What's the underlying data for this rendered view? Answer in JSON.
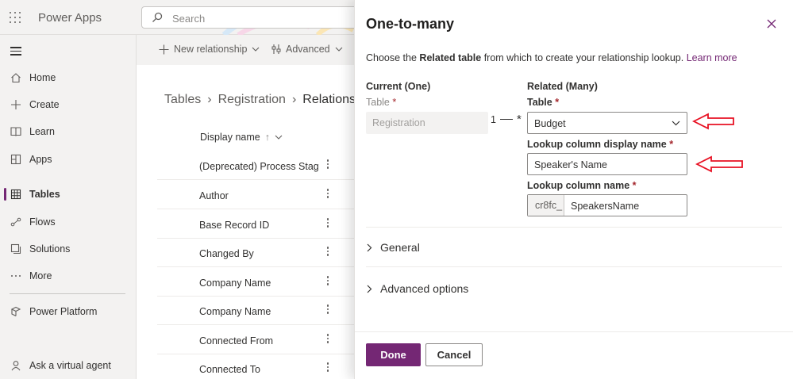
{
  "header": {
    "app_name": "Power Apps",
    "search_placeholder": "Search"
  },
  "nav": {
    "items": [
      {
        "label": "Home",
        "icon": "home-icon"
      },
      {
        "label": "Create",
        "icon": "plus-icon"
      },
      {
        "label": "Learn",
        "icon": "book-icon"
      },
      {
        "label": "Apps",
        "icon": "apps-icon"
      },
      {
        "label": "Tables",
        "icon": "table-icon",
        "active": true
      },
      {
        "label": "Flows",
        "icon": "flow-icon"
      },
      {
        "label": "Solutions",
        "icon": "solutions-icon"
      },
      {
        "label": "More",
        "icon": "ellipsis-icon"
      },
      {
        "label": "Power Platform",
        "icon": "power-platform-icon"
      },
      {
        "label": "Ask a virtual agent",
        "icon": "agent-icon"
      }
    ]
  },
  "commandbar": {
    "new_relationship": "New relationship",
    "advanced": "Advanced"
  },
  "breadcrumb": {
    "tables": "Tables",
    "table": "Registration",
    "current": "Relationsh"
  },
  "list": {
    "column_header": "Display name",
    "rows": [
      "(Deprecated) Process Stag",
      "Author",
      "Base Record ID",
      "Changed By",
      "Company Name",
      "Company Name",
      "Connected From",
      "Connected To"
    ]
  },
  "panel": {
    "title": "One-to-many",
    "desc_prefix": "Choose the ",
    "desc_bold": "Related table",
    "desc_suffix": " from which to create your relationship lookup. ",
    "learn_more": "Learn more",
    "current_heading": "Current (One)",
    "related_heading": "Related (Many)",
    "table_label": "Table",
    "required_mark": "*",
    "current_table_value": "Registration",
    "cardinality_one": "1",
    "cardinality_many": "*",
    "related_table_value": "Budget",
    "lookup_display_label": "Lookup column display name",
    "lookup_display_value": "Speaker's Name",
    "lookup_name_label": "Lookup column name",
    "lookup_prefix": "cr8fc_",
    "lookup_name_value": "SpeakersName",
    "general_label": "General",
    "advanced_label": "Advanced options",
    "done_label": "Done",
    "cancel_label": "Cancel"
  },
  "colors": {
    "accent": "#742774",
    "annotation_arrow": "#e81123"
  }
}
